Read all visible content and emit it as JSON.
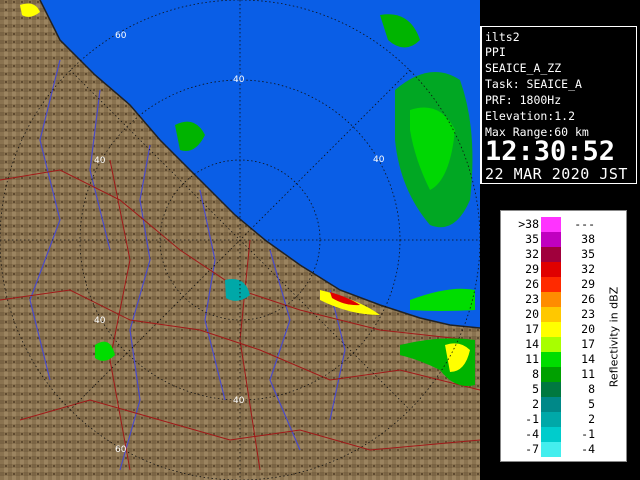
{
  "radar": {
    "site": "ilts2",
    "product": "PPI",
    "task_name": "SEAICE_A_ZZ",
    "task": "Task: SEAICE_A",
    "prf": "PRF: 1800Hz",
    "elevation": "Elevation:1.2",
    "max_range": "Max Range:60 km",
    "time": "12:30:52",
    "date": "22 MAR 2020 JST"
  },
  "range_labels": [
    "60",
    "40",
    "40",
    "40",
    "40",
    "40",
    "60"
  ],
  "legend": {
    "title": "Reflectivity in dBZ",
    "rows": [
      {
        "low": ">38",
        "high": "---",
        "color": "#ff33ff"
      },
      {
        "low": "35",
        "high": "38",
        "color": "#c000c0"
      },
      {
        "low": "32",
        "high": "35",
        "color": "#a0003c"
      },
      {
        "low": "29",
        "high": "32",
        "color": "#e00000"
      },
      {
        "low": "26",
        "high": "29",
        "color": "#ff2a00"
      },
      {
        "low": "23",
        "high": "26",
        "color": "#ff8c00"
      },
      {
        "low": "20",
        "high": "23",
        "color": "#ffc800"
      },
      {
        "low": "17",
        "high": "20",
        "color": "#ffff00"
      },
      {
        "low": "14",
        "high": "17",
        "color": "#a8ff00"
      },
      {
        "low": "11",
        "high": "14",
        "color": "#00dd00"
      },
      {
        "low": "8",
        "high": "11",
        "color": "#00a000"
      },
      {
        "low": "5",
        "high": "8",
        "color": "#007840"
      },
      {
        "low": "2",
        "high": "5",
        "color": "#008888"
      },
      {
        "low": "-1",
        "high": "2",
        "color": "#00a8a8"
      },
      {
        "low": "-4",
        "high": "-1",
        "color": "#00cccc"
      },
      {
        "low": "-7",
        "high": "-4",
        "color": "#44eeee"
      }
    ]
  },
  "colors": {
    "sea": "#0a5ee6",
    "land": "#8a7350",
    "land_dark": "#5e4a30",
    "rivers": "#4a4ac8",
    "boundaries": "#a01818"
  }
}
